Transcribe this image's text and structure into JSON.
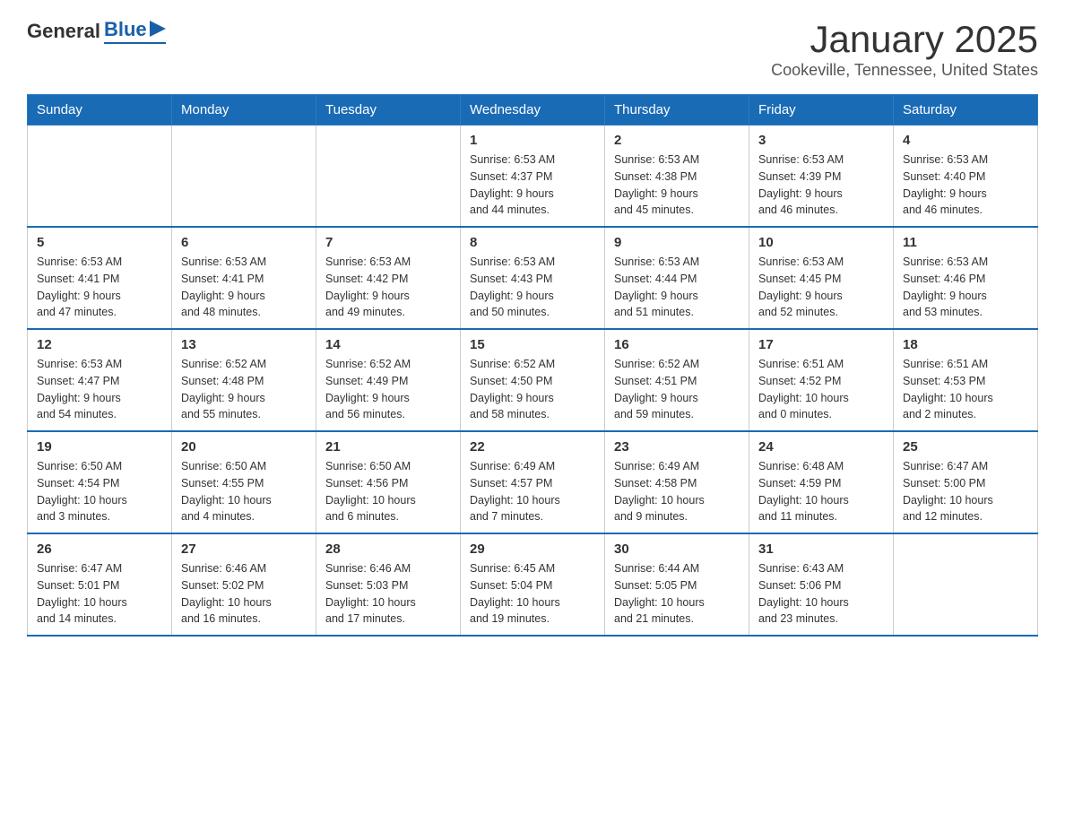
{
  "logo": {
    "text_general": "General",
    "text_blue": "Blue"
  },
  "header": {
    "month": "January 2025",
    "location": "Cookeville, Tennessee, United States"
  },
  "weekdays": [
    "Sunday",
    "Monday",
    "Tuesday",
    "Wednesday",
    "Thursday",
    "Friday",
    "Saturday"
  ],
  "weeks": [
    [
      {
        "day": "",
        "info": ""
      },
      {
        "day": "",
        "info": ""
      },
      {
        "day": "",
        "info": ""
      },
      {
        "day": "1",
        "info": "Sunrise: 6:53 AM\nSunset: 4:37 PM\nDaylight: 9 hours\nand 44 minutes."
      },
      {
        "day": "2",
        "info": "Sunrise: 6:53 AM\nSunset: 4:38 PM\nDaylight: 9 hours\nand 45 minutes."
      },
      {
        "day": "3",
        "info": "Sunrise: 6:53 AM\nSunset: 4:39 PM\nDaylight: 9 hours\nand 46 minutes."
      },
      {
        "day": "4",
        "info": "Sunrise: 6:53 AM\nSunset: 4:40 PM\nDaylight: 9 hours\nand 46 minutes."
      }
    ],
    [
      {
        "day": "5",
        "info": "Sunrise: 6:53 AM\nSunset: 4:41 PM\nDaylight: 9 hours\nand 47 minutes."
      },
      {
        "day": "6",
        "info": "Sunrise: 6:53 AM\nSunset: 4:41 PM\nDaylight: 9 hours\nand 48 minutes."
      },
      {
        "day": "7",
        "info": "Sunrise: 6:53 AM\nSunset: 4:42 PM\nDaylight: 9 hours\nand 49 minutes."
      },
      {
        "day": "8",
        "info": "Sunrise: 6:53 AM\nSunset: 4:43 PM\nDaylight: 9 hours\nand 50 minutes."
      },
      {
        "day": "9",
        "info": "Sunrise: 6:53 AM\nSunset: 4:44 PM\nDaylight: 9 hours\nand 51 minutes."
      },
      {
        "day": "10",
        "info": "Sunrise: 6:53 AM\nSunset: 4:45 PM\nDaylight: 9 hours\nand 52 minutes."
      },
      {
        "day": "11",
        "info": "Sunrise: 6:53 AM\nSunset: 4:46 PM\nDaylight: 9 hours\nand 53 minutes."
      }
    ],
    [
      {
        "day": "12",
        "info": "Sunrise: 6:53 AM\nSunset: 4:47 PM\nDaylight: 9 hours\nand 54 minutes."
      },
      {
        "day": "13",
        "info": "Sunrise: 6:52 AM\nSunset: 4:48 PM\nDaylight: 9 hours\nand 55 minutes."
      },
      {
        "day": "14",
        "info": "Sunrise: 6:52 AM\nSunset: 4:49 PM\nDaylight: 9 hours\nand 56 minutes."
      },
      {
        "day": "15",
        "info": "Sunrise: 6:52 AM\nSunset: 4:50 PM\nDaylight: 9 hours\nand 58 minutes."
      },
      {
        "day": "16",
        "info": "Sunrise: 6:52 AM\nSunset: 4:51 PM\nDaylight: 9 hours\nand 59 minutes."
      },
      {
        "day": "17",
        "info": "Sunrise: 6:51 AM\nSunset: 4:52 PM\nDaylight: 10 hours\nand 0 minutes."
      },
      {
        "day": "18",
        "info": "Sunrise: 6:51 AM\nSunset: 4:53 PM\nDaylight: 10 hours\nand 2 minutes."
      }
    ],
    [
      {
        "day": "19",
        "info": "Sunrise: 6:50 AM\nSunset: 4:54 PM\nDaylight: 10 hours\nand 3 minutes."
      },
      {
        "day": "20",
        "info": "Sunrise: 6:50 AM\nSunset: 4:55 PM\nDaylight: 10 hours\nand 4 minutes."
      },
      {
        "day": "21",
        "info": "Sunrise: 6:50 AM\nSunset: 4:56 PM\nDaylight: 10 hours\nand 6 minutes."
      },
      {
        "day": "22",
        "info": "Sunrise: 6:49 AM\nSunset: 4:57 PM\nDaylight: 10 hours\nand 7 minutes."
      },
      {
        "day": "23",
        "info": "Sunrise: 6:49 AM\nSunset: 4:58 PM\nDaylight: 10 hours\nand 9 minutes."
      },
      {
        "day": "24",
        "info": "Sunrise: 6:48 AM\nSunset: 4:59 PM\nDaylight: 10 hours\nand 11 minutes."
      },
      {
        "day": "25",
        "info": "Sunrise: 6:47 AM\nSunset: 5:00 PM\nDaylight: 10 hours\nand 12 minutes."
      }
    ],
    [
      {
        "day": "26",
        "info": "Sunrise: 6:47 AM\nSunset: 5:01 PM\nDaylight: 10 hours\nand 14 minutes."
      },
      {
        "day": "27",
        "info": "Sunrise: 6:46 AM\nSunset: 5:02 PM\nDaylight: 10 hours\nand 16 minutes."
      },
      {
        "day": "28",
        "info": "Sunrise: 6:46 AM\nSunset: 5:03 PM\nDaylight: 10 hours\nand 17 minutes."
      },
      {
        "day": "29",
        "info": "Sunrise: 6:45 AM\nSunset: 5:04 PM\nDaylight: 10 hours\nand 19 minutes."
      },
      {
        "day": "30",
        "info": "Sunrise: 6:44 AM\nSunset: 5:05 PM\nDaylight: 10 hours\nand 21 minutes."
      },
      {
        "day": "31",
        "info": "Sunrise: 6:43 AM\nSunset: 5:06 PM\nDaylight: 10 hours\nand 23 minutes."
      },
      {
        "day": "",
        "info": ""
      }
    ]
  ]
}
